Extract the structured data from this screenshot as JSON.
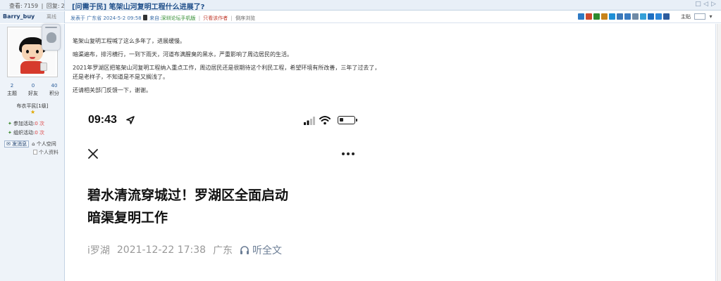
{
  "header": {
    "views_label": "查看:",
    "views_count": "7159",
    "replies_label": "回复:",
    "replies_count": "2",
    "thread_title": "[问需于民] 笔架山河复明工程什么进展了?"
  },
  "user": {
    "name": "Barry_buy",
    "status": "离线",
    "stats": [
      {
        "num": "2",
        "label": "主题"
      },
      {
        "num": "0",
        "label": "好友"
      },
      {
        "num": "40",
        "label": "积分"
      }
    ],
    "rank": "布衣平民[1级]",
    "activity_join_label": "参加活动:",
    "activity_join_count": "0 次",
    "activity_org_label": "组织活动:",
    "activity_org_count": "0 次",
    "send_message": "发消息",
    "personal_space": "个人空间",
    "profile": "个人资料"
  },
  "meta": {
    "posted_prefix": "发表于 广东省 2024-5-2 09:58",
    "from_label": "来自:",
    "from_source": "深圳论坛手机版",
    "author_only": "只看该作者",
    "reverse_view": "倒序浏览"
  },
  "toolbar": {
    "font_label": "主贴",
    "icons": [
      "share-icon",
      "print-icon",
      "favorite-icon",
      "email-icon",
      "qq-icon",
      "weibo-icon",
      "report-icon",
      "copy-icon",
      "translate-icon",
      "help-icon",
      "next-icon",
      "text-icon"
    ],
    "icon_colors": [
      "#2e7ac4",
      "#d04a2c",
      "#2e8b2e",
      "#c7831a",
      "#1f8fd6",
      "#3c78b8",
      "#3a7cc2",
      "#6f8aa6",
      "#35a0d8",
      "#1f6fc1",
      "#2d87d9",
      "#2d5c9e"
    ]
  },
  "post": {
    "paragraphs": [
      "笔架山复明工程喊了这么多年了，进展缓慢。",
      "暗渠遍布，排污横行，一到下雨天，河道布满腥臭的黑水，严重影响了周边居民的生活。",
      "2021年罗湖区把笔架山河复明工程纳入重点工作，周边居民还是很期待这个利民工程，希望环境有所改善，三年了过去了，还是老样子，不知道是不是又搁浅了。",
      "还请相关部门反馈一下，谢谢。"
    ]
  },
  "screenshot": {
    "time": "09:43",
    "headline_line1": "碧水清流穿城过！罗湖区全面启动",
    "headline_line2": "暗渠复明工作",
    "source": "i罗湖",
    "datetime": "2021-12-22 17:38",
    "region": "广东",
    "listen": "听全文"
  }
}
